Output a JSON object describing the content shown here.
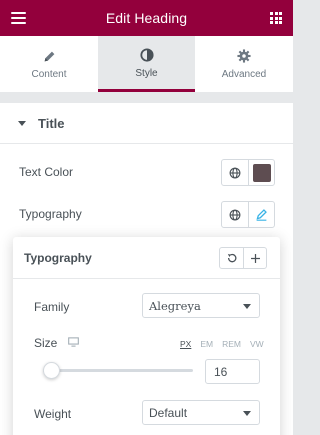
{
  "header": {
    "title": "Edit Heading"
  },
  "tabs": [
    {
      "label": "Content",
      "icon": "pencil-icon"
    },
    {
      "label": "Style",
      "icon": "half-circle-icon",
      "active": true
    },
    {
      "label": "Advanced",
      "icon": "gear-icon"
    }
  ],
  "section": {
    "title": "Title",
    "expanded": true
  },
  "controls": {
    "text_color_label": "Text Color",
    "text_color_value": "#5e4d51",
    "typography_label": "Typography"
  },
  "popover": {
    "title": "Typography",
    "family_label": "Family",
    "family_value": "Alegreya",
    "size_label": "Size",
    "units": [
      "PX",
      "EM",
      "REM",
      "VW"
    ],
    "active_unit": "PX",
    "size_value": "16",
    "size_slider_fraction": 0.05,
    "weight_label": "Weight",
    "weight_value": "Default"
  },
  "colors": {
    "brand": "#93003c",
    "accent_edit": "#71d7f7"
  }
}
